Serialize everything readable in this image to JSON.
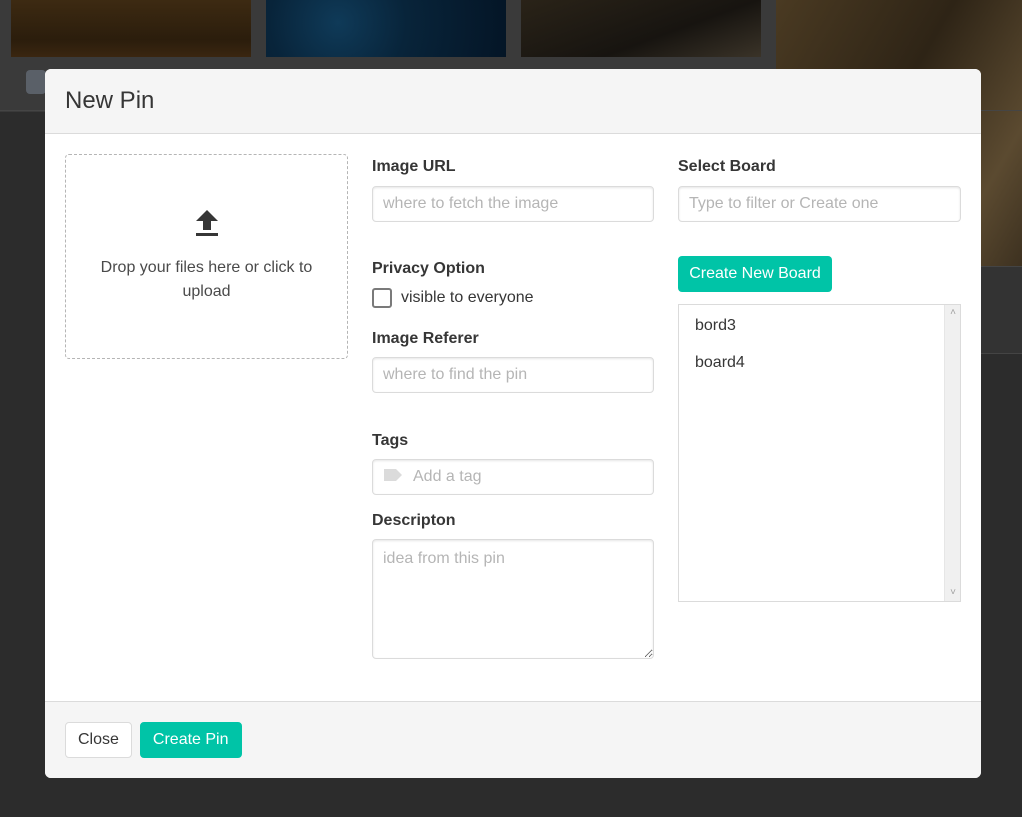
{
  "modal": {
    "title": "New Pin"
  },
  "dropzone": {
    "text": "Drop your files here or click to upload",
    "icon": "upload-icon"
  },
  "image_url": {
    "label": "Image URL",
    "placeholder": "where to fetch the image",
    "value": ""
  },
  "privacy": {
    "label": "Privacy Option",
    "checkbox_label": "visible to everyone",
    "checked": false
  },
  "image_referer": {
    "label": "Image Referer",
    "placeholder": "where to find the pin",
    "value": ""
  },
  "tags": {
    "label": "Tags",
    "placeholder": "Add a tag",
    "icon": "tag-icon"
  },
  "description": {
    "label": "Descripton",
    "placeholder": "idea from this pin",
    "value": ""
  },
  "board": {
    "label": "Select Board",
    "placeholder": "Type to filter or Create one",
    "create_button": "Create New Board",
    "items": [
      {
        "label": "bord3"
      },
      {
        "label": "board4"
      }
    ]
  },
  "footer": {
    "close_label": "Close",
    "create_label": "Create Pin"
  },
  "colors": {
    "accent": "#00c4a7",
    "overlay": "#2c2c2c"
  }
}
